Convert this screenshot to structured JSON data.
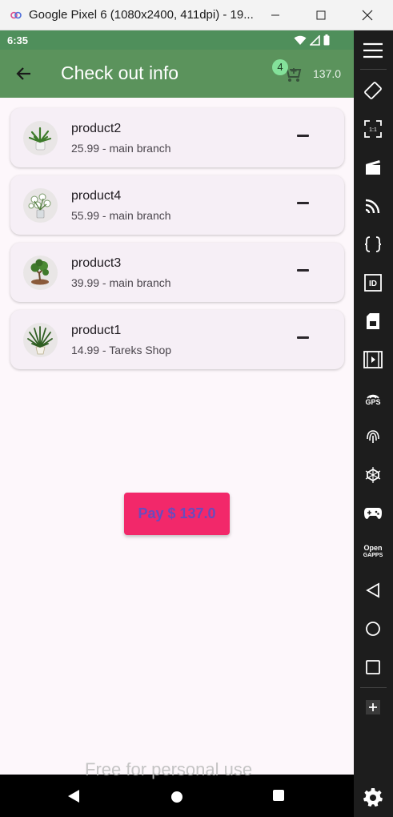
{
  "window": {
    "title": "Google Pixel 6 (1080x2400, 411dpi) - 19..."
  },
  "status_bar": {
    "time": "6:35"
  },
  "app_bar": {
    "title": "Check out info",
    "cart_count": "4",
    "cart_total": "137.0"
  },
  "products": [
    {
      "name": "product2",
      "detail": "25.99 - main branch"
    },
    {
      "name": "product4",
      "detail": "55.99 - main branch"
    },
    {
      "name": "product3",
      "detail": "39.99 - main branch"
    },
    {
      "name": "product1",
      "detail": "14.99 - Tareks Shop"
    }
  ],
  "pay_button": {
    "label": "Pay $ 137.0"
  },
  "watermark": "Free for personal use",
  "emulator_toolbar": {
    "gps_label": "GPS",
    "open_gapps_label_line1": "Open",
    "open_gapps_label_line2": "GAPPS"
  },
  "colors": {
    "app_bar": "#5b935c",
    "status_bar": "#4f8f5b",
    "pay_button_bg": "#f2286a",
    "pay_button_text": "#6a4bbd",
    "badge": "#84e19a",
    "background": "#fdf7fb"
  }
}
